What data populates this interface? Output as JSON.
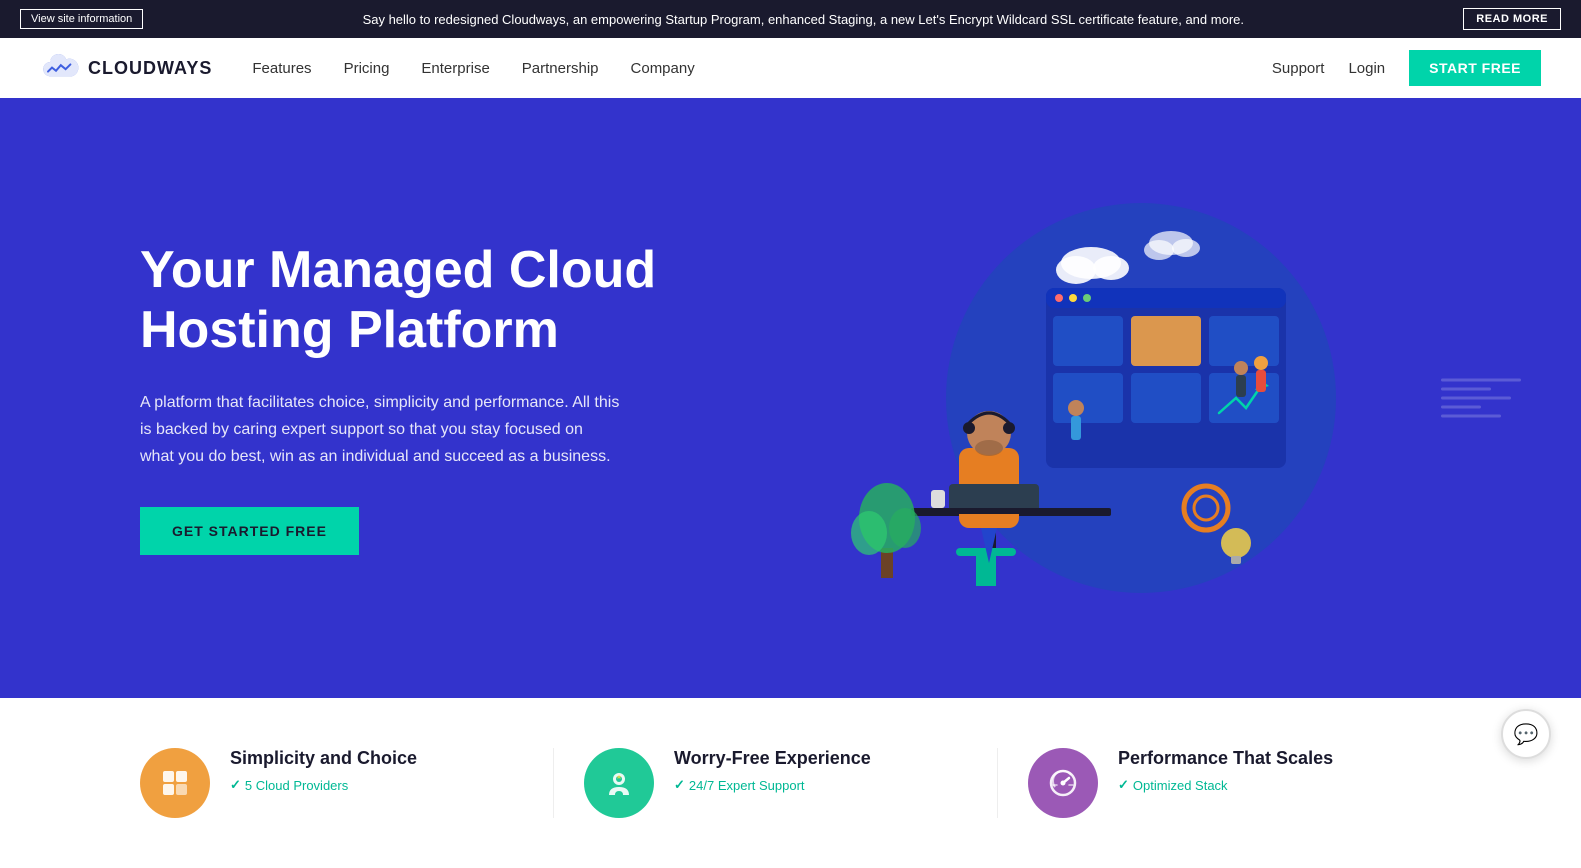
{
  "announcement": {
    "site_info_label": "View site information",
    "text": "Say hello to redesigned Cloudways, an empowering Startup Program, enhanced Staging, a new Let's Encrypt Wildcard SSL certificate feature, and more.",
    "read_more_label": "READ MORE"
  },
  "navbar": {
    "logo_text": "CLOUDWAYS",
    "nav_links": [
      {
        "label": "Features",
        "id": "features"
      },
      {
        "label": "Pricing",
        "id": "pricing"
      },
      {
        "label": "Enterprise",
        "id": "enterprise"
      },
      {
        "label": "Partnership",
        "id": "partnership"
      },
      {
        "label": "Company",
        "id": "company"
      }
    ],
    "support_label": "Support",
    "login_label": "Login",
    "start_free_label": "START FREE"
  },
  "hero": {
    "title": "Your Managed Cloud Hosting Platform",
    "subtitle": "A platform that facilitates choice, simplicity and performance. All this is backed by caring expert support so that you stay focused on what you do best, win as an individual and succeed as a business.",
    "cta_label": "GET STARTED FREE"
  },
  "features": [
    {
      "icon": "⧉",
      "icon_style": "orange",
      "title": "Simplicity and Choice",
      "sub_text": "5 Cloud Providers"
    },
    {
      "icon": "👤",
      "icon_style": "teal",
      "title": "Worry-Free Experience",
      "sub_text": "24/7 Expert Support"
    },
    {
      "icon": "⏱",
      "icon_style": "purple",
      "title": "Performance That Scales",
      "sub_text": "Optimized Stack"
    }
  ],
  "chat": {
    "icon": "💬"
  }
}
